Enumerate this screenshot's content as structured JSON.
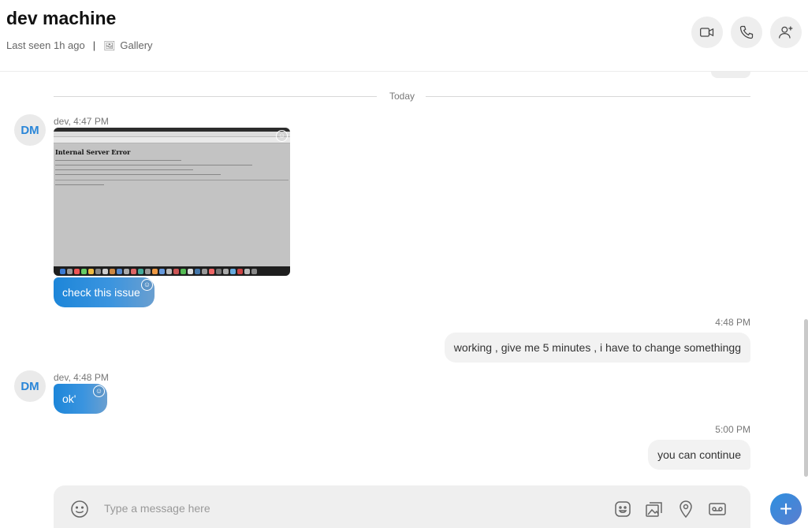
{
  "header": {
    "title": "dev machine",
    "last_seen": "Last seen 1h ago",
    "separator": "|",
    "gallery_label": "Gallery",
    "gallery_icon": "gallery-icon",
    "buttons": [
      "video-call-icon",
      "audio-call-icon",
      "add-person-icon"
    ]
  },
  "chat": {
    "divider_label": "Today",
    "messages": [
      {
        "type": "incoming",
        "avatar": "DM",
        "sender_time": "dev, 4:47 PM",
        "image": {
          "heading": "Internal Server Error",
          "description": "screenshot of a browser showing a server error page"
        },
        "text": "check this issue"
      },
      {
        "type": "outgoing",
        "time": "4:48 PM",
        "text": "working , give me 5 minutes , i have to change somethingg"
      },
      {
        "type": "incoming",
        "avatar": "DM",
        "sender_time": "dev, 4:48 PM",
        "text": "ok'"
      },
      {
        "type": "outgoing",
        "time": "5:00 PM",
        "text": "you can continue"
      }
    ]
  },
  "composer": {
    "placeholder": "Type a message here",
    "value": "",
    "icons": [
      "emoji-icon",
      "sticker-icon",
      "media-icon",
      "location-icon",
      "video-message-icon"
    ],
    "plus_label": "+"
  },
  "colors": {
    "accent": "#1d86d9",
    "incoming_gradient_end": "#6a9fd0",
    "outgoing_bubble": "#f2f2f2",
    "avatar_text": "#2a86d8"
  }
}
